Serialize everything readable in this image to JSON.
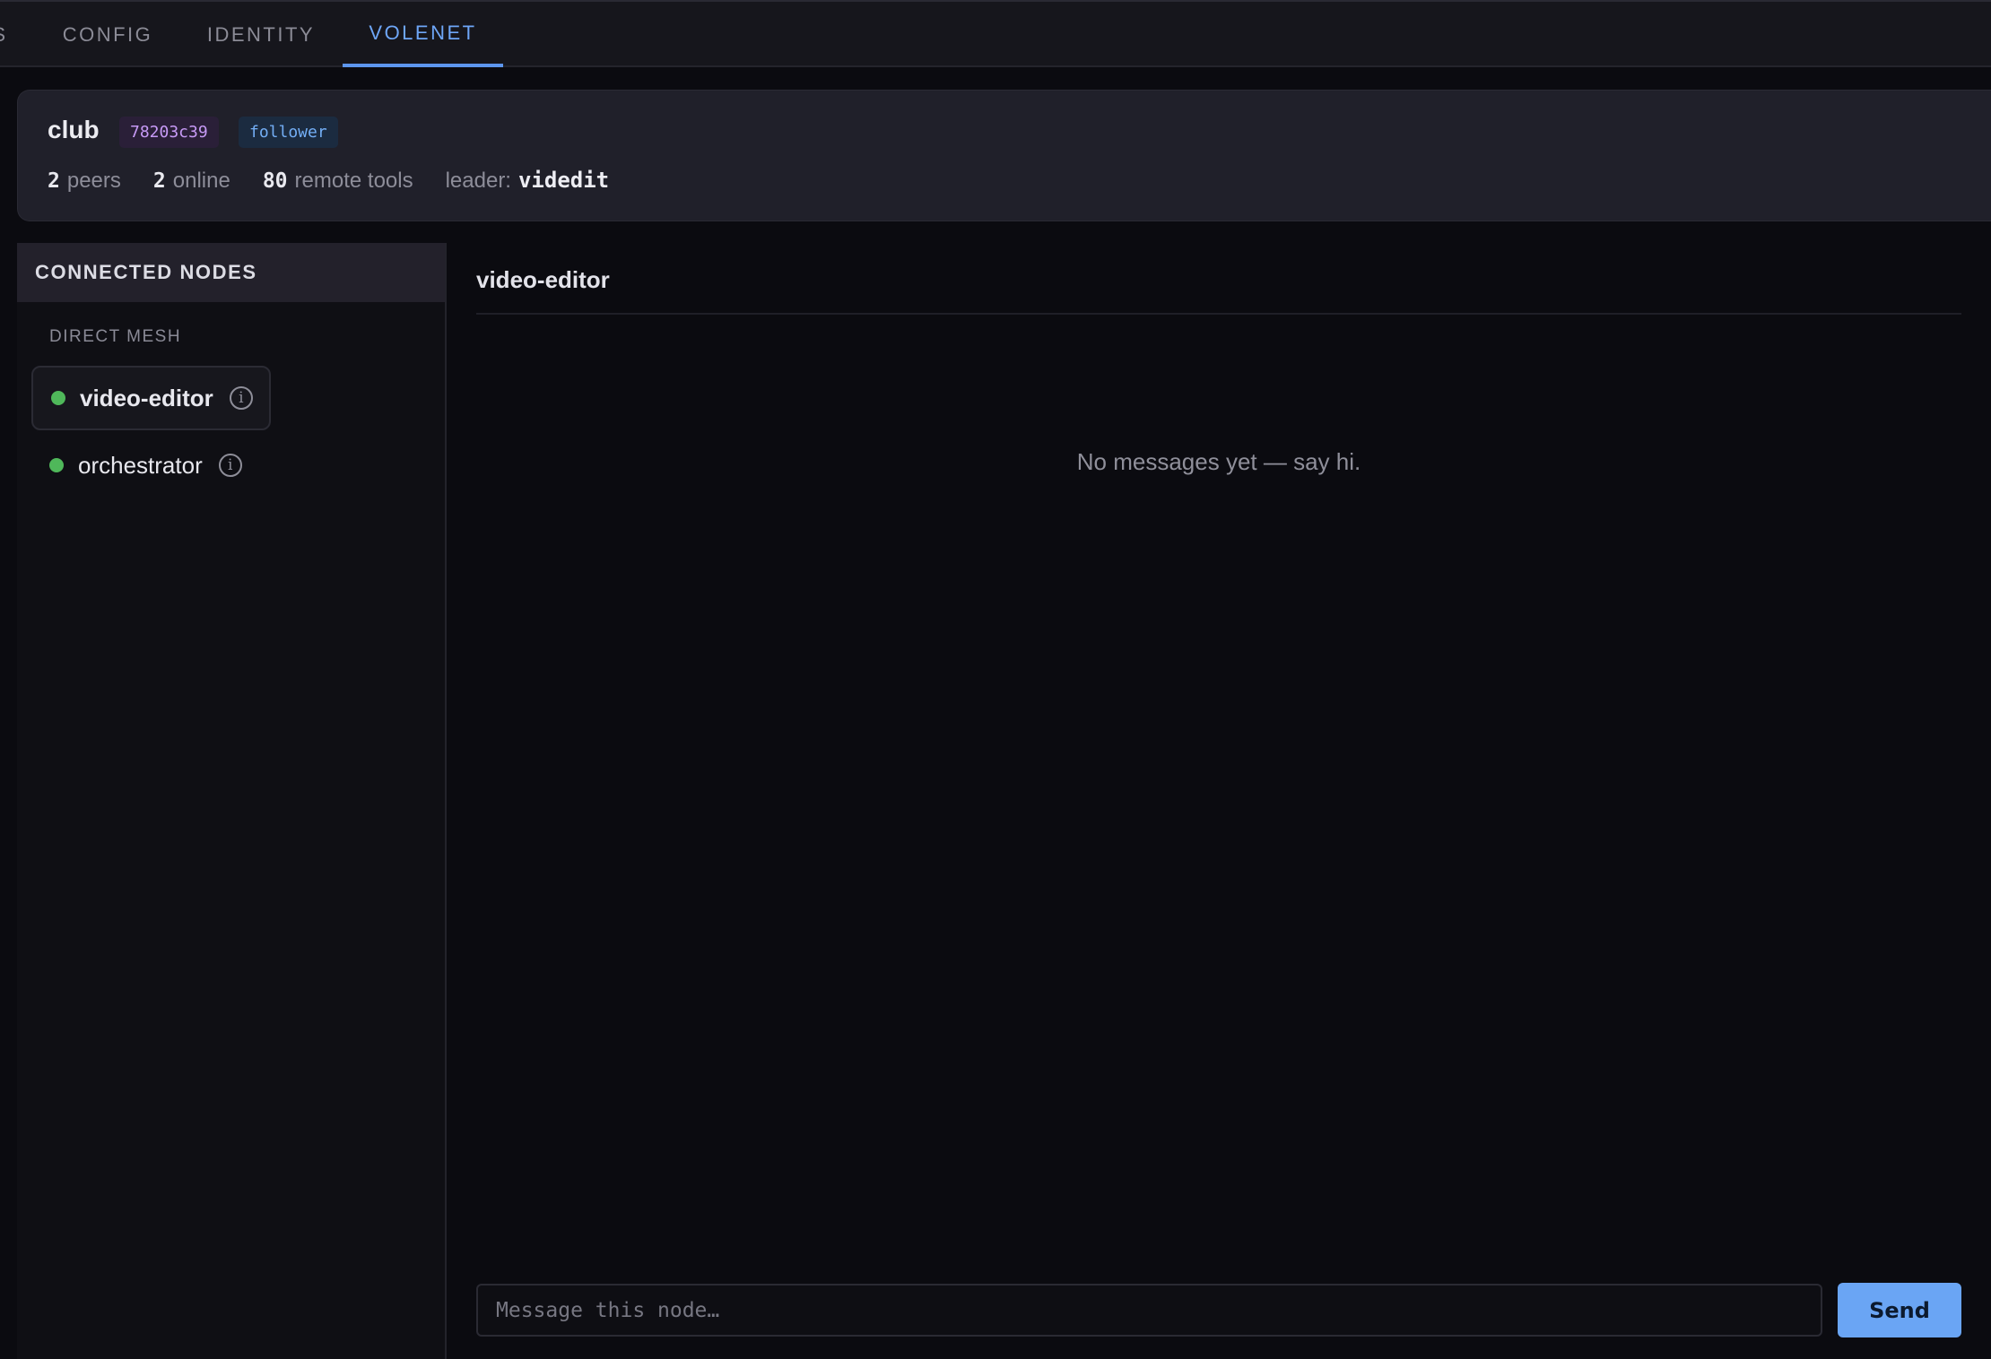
{
  "tabs": [
    {
      "label": "S",
      "active": false
    },
    {
      "label": "CONFIG",
      "active": false
    },
    {
      "label": "IDENTITY",
      "active": false
    },
    {
      "label": "VOLENET",
      "active": true
    }
  ],
  "club": {
    "name": "club",
    "id_badge": "78203c39",
    "role_badge": "follower",
    "peers_count": "2",
    "peers_label": "peers",
    "online_count": "2",
    "online_label": "online",
    "tools_count": "80",
    "tools_label": "remote tools",
    "leader_label": "leader:",
    "leader_value": "videdit"
  },
  "sidebar": {
    "title": "CONNECTED NODES",
    "section_label": "DIRECT MESH",
    "nodes": [
      {
        "name": "video-editor",
        "status": "online",
        "selected": true
      },
      {
        "name": "orchestrator",
        "status": "online",
        "selected": false
      }
    ]
  },
  "chat": {
    "title": "video-editor",
    "empty_text": "No messages yet — say hi.",
    "input_placeholder": "Message this node…",
    "send_label": "Send"
  },
  "colors": {
    "accent": "#6aa5f4",
    "online": "#4fb85a",
    "id_badge": "#c79af6",
    "role_badge": "#73aef5"
  }
}
